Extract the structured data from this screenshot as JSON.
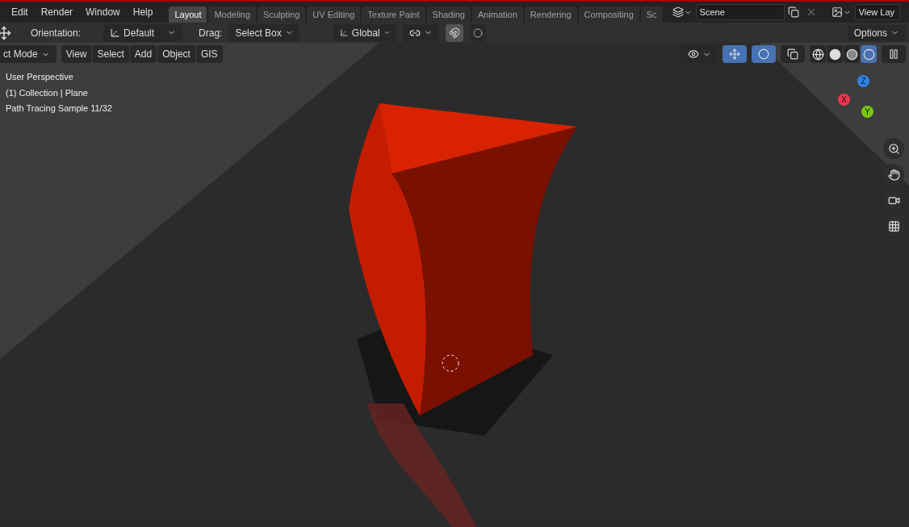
{
  "menus": [
    "Edit",
    "Render",
    "Window",
    "Help"
  ],
  "workspace_tabs": [
    {
      "label": "Layout",
      "selected": true
    },
    {
      "label": "Modeling",
      "selected": false
    },
    {
      "label": "Sculpting",
      "selected": false
    },
    {
      "label": "UV Editing",
      "selected": false
    },
    {
      "label": "Texture Paint",
      "selected": false
    },
    {
      "label": "Shading",
      "selected": false
    },
    {
      "label": "Animation",
      "selected": false
    },
    {
      "label": "Rendering",
      "selected": false
    },
    {
      "label": "Compositing",
      "selected": false
    },
    {
      "label": "Sc",
      "selected": false
    }
  ],
  "scene": {
    "value": "Scene"
  },
  "view_layer": {
    "value": "View Lay"
  },
  "tool_settings": {
    "orientation_label": "Orientation:",
    "orientation": "Default",
    "drag_label": "Drag:",
    "drag": "Select Box",
    "transform_orientation": "Global",
    "snap_on": true,
    "proportional_on": false,
    "options": "Options"
  },
  "viewport_header": {
    "mode": "ct Mode",
    "menus": [
      "View",
      "Select",
      "Add",
      "Object",
      "GIS"
    ],
    "gizmos_on": true,
    "overlays_on": true,
    "xray_on": false
  },
  "shading_modes": [
    {
      "kind": "wireframe",
      "selected": false
    },
    {
      "kind": "solid",
      "selected": false
    },
    {
      "kind": "material",
      "selected": false
    },
    {
      "kind": "rendered",
      "selected": true
    }
  ],
  "viewport_info": [
    "User Perspective",
    "(1) Collection | Plane",
    "Path Tracing Sample 11/32"
  ],
  "axis_gizmo": [
    {
      "label": "Z",
      "color": "#2f83e6"
    },
    {
      "label": "X",
      "color": "#f0354f"
    },
    {
      "label": "Y",
      "color": "#7bc811"
    }
  ]
}
